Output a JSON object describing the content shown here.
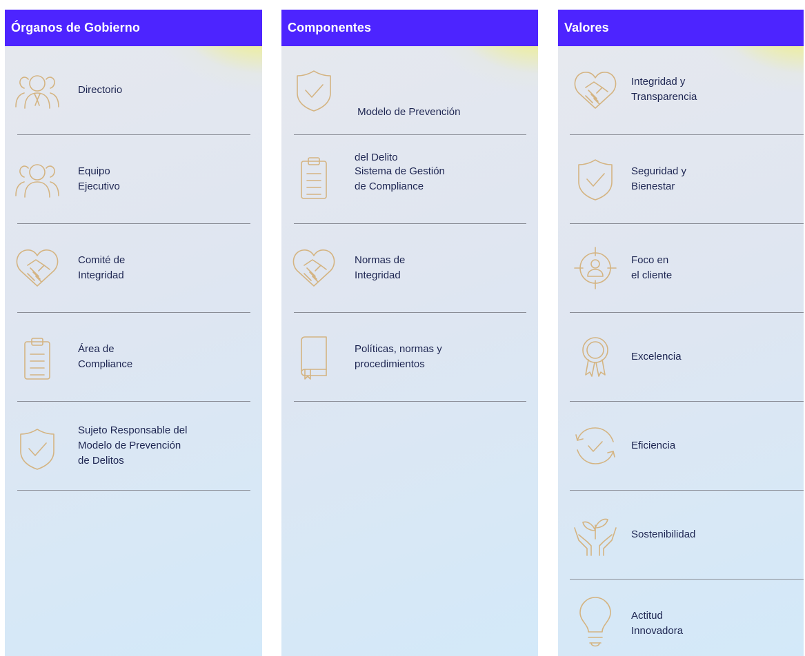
{
  "columns": [
    {
      "title": "Órganos de Gobierno",
      "items": [
        {
          "icon": "people-icon",
          "line1": "Directorio",
          "line2": "",
          "line3": ""
        },
        {
          "icon": "people-icon",
          "line1": "Equipo",
          "line2": "Ejecutivo",
          "line3": ""
        },
        {
          "icon": "handshake-heart-icon",
          "line1": "Comité de",
          "line2": "Integridad",
          "line3": ""
        },
        {
          "icon": "clipboard-icon",
          "line1": "Área de",
          "line2": "Compliance",
          "line3": ""
        },
        {
          "icon": "shield-check-icon",
          "line1": "Sujeto Responsable del",
          "line2": "Modelo de Prevención",
          "line3": "de Delitos"
        }
      ]
    },
    {
      "title": "Componentes",
      "items": [
        {
          "icon": "shield-check-icon",
          "line1": " Modelo de Prevención",
          "line2": "del Delito"
        },
        {
          "icon": "clipboard-icon",
          "line1": "Sistema de Gestión",
          "line2": "de Compliance"
        },
        {
          "icon": "handshake-heart-icon",
          "line1": "Normas de",
          "line2": "Integridad"
        },
        {
          "icon": "book-icon",
          "line1": "Políticas, normas y",
          "line2": "procedimientos"
        }
      ]
    },
    {
      "title": "Valores",
      "items": [
        {
          "icon": "handshake-heart-icon",
          "line1": "Integridad y",
          "line2": "Transparencia"
        },
        {
          "icon": "shield-check-icon",
          "line1": "Seguridad y",
          "line2": "Bienestar"
        },
        {
          "icon": "target-person-icon",
          "line1": "Foco en",
          "line2": "el cliente"
        },
        {
          "icon": "award-ribbon-icon",
          "line1": "Excelencia",
          "line2": ""
        },
        {
          "icon": "cycle-check-icon",
          "line1": "Eficiencia",
          "line2": ""
        },
        {
          "icon": "hands-plant-icon",
          "line1": "Sostenibilidad",
          "line2": ""
        },
        {
          "icon": "lightbulb-icon",
          "line1": "Actitud",
          "line2": "Innovadora"
        }
      ]
    }
  ],
  "colors": {
    "header": "#4d24ff",
    "icon": "#d4b482",
    "text": "#1e2652",
    "divider": "#8a8d96",
    "highlight": "#fffb00"
  }
}
